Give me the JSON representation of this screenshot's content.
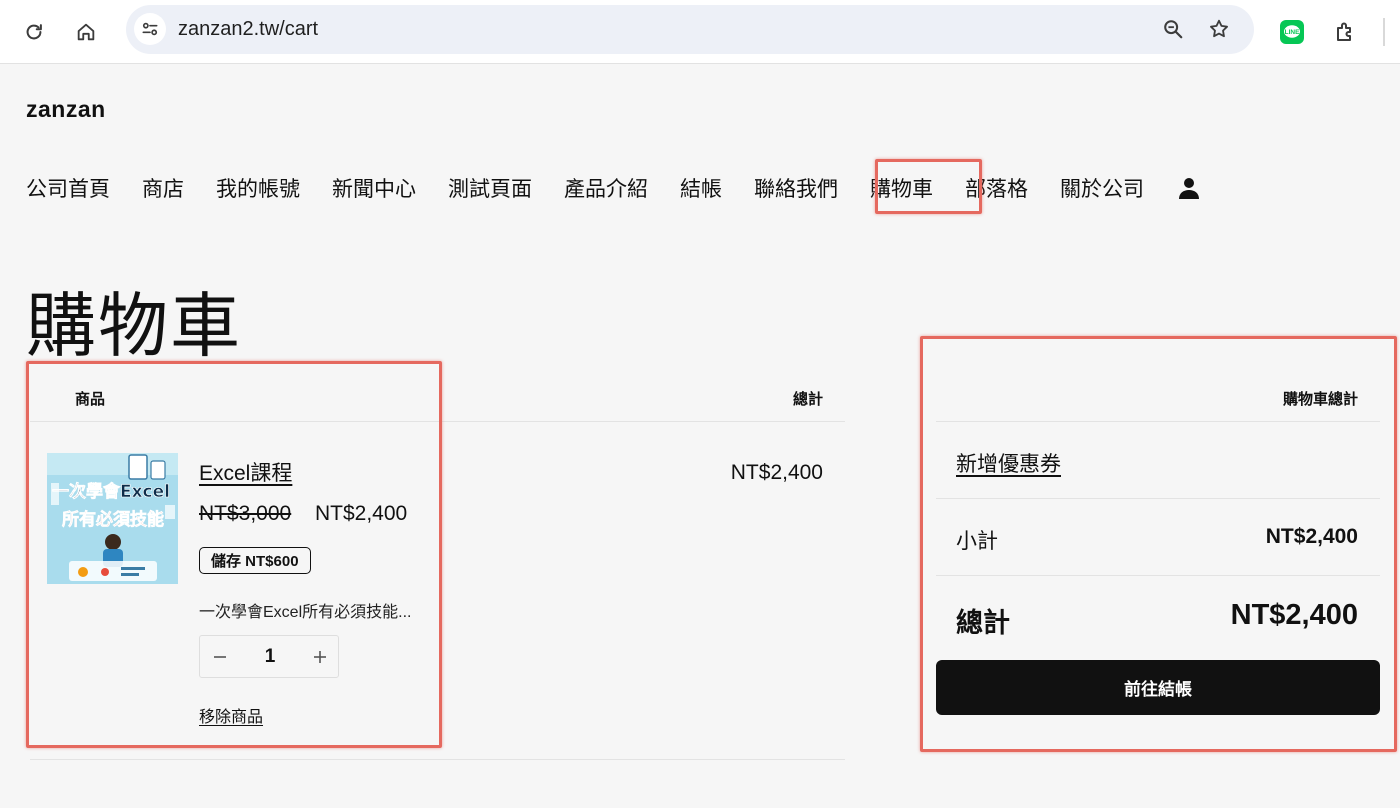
{
  "browser": {
    "url": "zanzan2.tw/cart",
    "icons": [
      "reload-icon",
      "home-icon",
      "site-info-icon",
      "zoom-icon",
      "star-icon",
      "line-extension-icon",
      "extensions-icon"
    ]
  },
  "site": {
    "brand": "zanzan",
    "nav": [
      "公司首頁",
      "商店",
      "我的帳號",
      "新聞中心",
      "測試頁面",
      "產品介紹",
      "結帳",
      "聯絡我們",
      "購物車",
      "部落格",
      "關於公司"
    ]
  },
  "page": {
    "title": "購物車"
  },
  "cart": {
    "col_product": "商品",
    "col_total": "總計",
    "item": {
      "name": "Excel課程",
      "price_original": "NT$3,000",
      "price_sale": "NT$2,400",
      "savings": "儲存 NT$600",
      "description": "一次學會Excel所有必須技能...",
      "quantity": "1",
      "remove_label": "移除商品",
      "line_total": "NT$2,400",
      "thumb_text_1": "一次學會Excel",
      "thumb_text_2": "所有必須技能"
    }
  },
  "totals": {
    "heading": "購物車總計",
    "coupon_label": "新增優惠券",
    "subtotal_label": "小計",
    "subtotal_value": "NT$2,400",
    "total_label": "總計",
    "total_value": "NT$2,400",
    "checkout_label": "前往結帳"
  },
  "colors": {
    "highlight": "#e5695f",
    "button_bg": "#111111",
    "line_icon": "#06c755"
  }
}
